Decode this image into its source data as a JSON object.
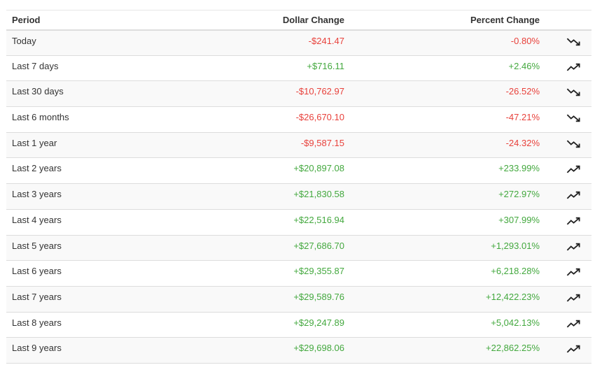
{
  "table": {
    "headers": {
      "period": "Period",
      "dollar": "Dollar Change",
      "percent": "Percent Change"
    },
    "rows": [
      {
        "period": "Today",
        "dollar": "-$241.47",
        "percent": "-0.80%",
        "direction": "down"
      },
      {
        "period": "Last 7 days",
        "dollar": "+$716.11",
        "percent": "+2.46%",
        "direction": "up"
      },
      {
        "period": "Last 30 days",
        "dollar": "-$10,762.97",
        "percent": "-26.52%",
        "direction": "down"
      },
      {
        "period": "Last 6 months",
        "dollar": "-$26,670.10",
        "percent": "-47.21%",
        "direction": "down"
      },
      {
        "period": "Last 1 year",
        "dollar": "-$9,587.15",
        "percent": "-24.32%",
        "direction": "down"
      },
      {
        "period": "Last 2 years",
        "dollar": "+$20,897.08",
        "percent": "+233.99%",
        "direction": "up"
      },
      {
        "period": "Last 3 years",
        "dollar": "+$21,830.58",
        "percent": "+272.97%",
        "direction": "up"
      },
      {
        "period": "Last 4 years",
        "dollar": "+$22,516.94",
        "percent": "+307.99%",
        "direction": "up"
      },
      {
        "period": "Last 5 years",
        "dollar": "+$27,686.70",
        "percent": "+1,293.01%",
        "direction": "up"
      },
      {
        "period": "Last 6 years",
        "dollar": "+$29,355.87",
        "percent": "+6,218.28%",
        "direction": "up"
      },
      {
        "period": "Last 7 years",
        "dollar": "+$29,589.76",
        "percent": "+12,422.23%",
        "direction": "up"
      },
      {
        "period": "Last 8 years",
        "dollar": "+$29,247.89",
        "percent": "+5,042.13%",
        "direction": "up"
      },
      {
        "period": "Last 9 years",
        "dollar": "+$29,698.06",
        "percent": "+22,862.25%",
        "direction": "up"
      }
    ]
  },
  "icons": {
    "up": "trending-up-icon",
    "down": "trending-down-icon"
  },
  "colors": {
    "negative": "#e8413b",
    "positive": "#43a83e",
    "stripe": "#f9f9f9",
    "border": "#dddddd",
    "icon": "#222222"
  }
}
